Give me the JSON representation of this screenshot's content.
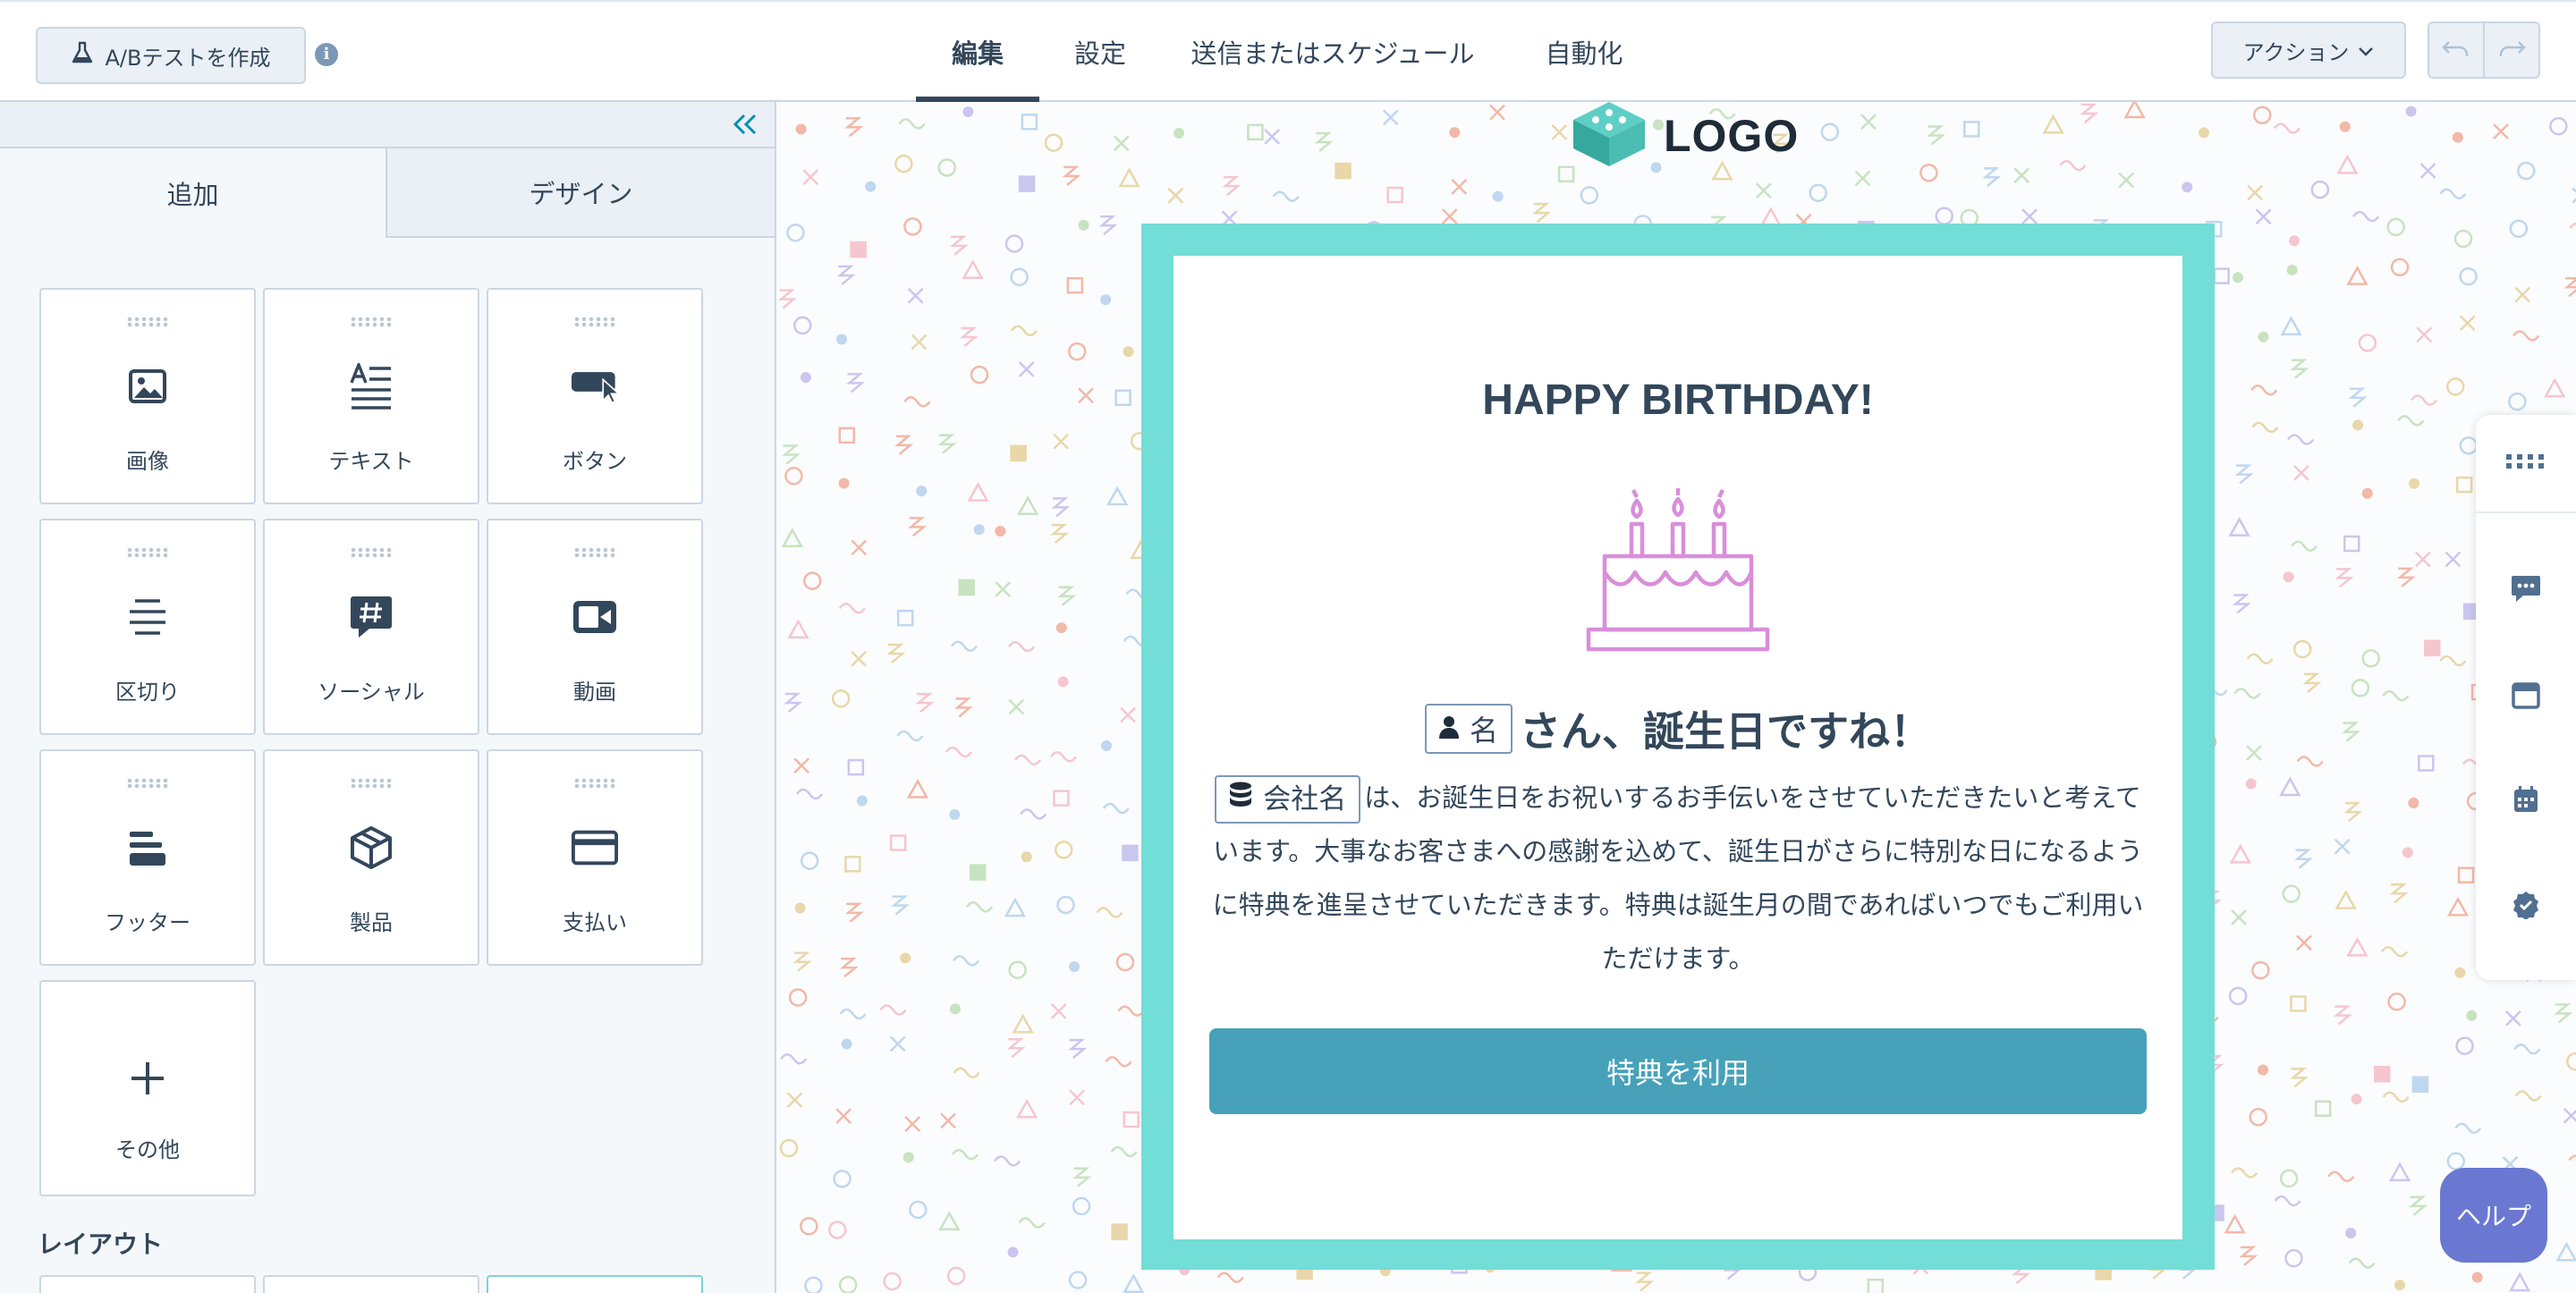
{
  "toolbar": {
    "ab_test_label": "A/Bテストを作成",
    "info_glyph": "i",
    "actions_label": "アクション"
  },
  "tabs": [
    {
      "label": "編集",
      "active": true
    },
    {
      "label": "設定",
      "active": false
    },
    {
      "label": "送信またはスケジュール",
      "active": false
    },
    {
      "label": "自動化",
      "active": false
    }
  ],
  "panel": {
    "tabs": [
      {
        "label": "追加",
        "active": true
      },
      {
        "label": "デザイン",
        "active": false
      }
    ],
    "modules": [
      {
        "label": "画像",
        "icon": "image-icon"
      },
      {
        "label": "テキスト",
        "icon": "text-icon"
      },
      {
        "label": "ボタン",
        "icon": "button-icon"
      },
      {
        "label": "区切り",
        "icon": "divider-icon"
      },
      {
        "label": "ソーシャル",
        "icon": "social-icon"
      },
      {
        "label": "動画",
        "icon": "video-icon"
      },
      {
        "label": "フッター",
        "icon": "footer-icon"
      },
      {
        "label": "製品",
        "icon": "product-icon"
      },
      {
        "label": "支払い",
        "icon": "payment-icon"
      },
      {
        "label": "その他",
        "icon": "plus-icon"
      }
    ],
    "layout_title": "レイアウト"
  },
  "email": {
    "logo_text": "LOGO",
    "title": "HAPPY BIRTHDAY!",
    "first_name_token": "名",
    "greeting_suffix": "さん、誕生日ですね！",
    "company_token": "会社名",
    "body": "は、お誕生日をお祝いするお手伝いをさせていただきたいと考えています。大事なお客さまへの感謝を込めて、誕生日がさらに特別な日になるように特典を進呈させていただきます。特典は誕生月の間であればいつでもご利用いただけます。",
    "cta_label": "特典を利用"
  },
  "help_label": "ヘルプ",
  "colors": {
    "frame": "#73ddd7",
    "cta": "#46a1b9",
    "cake": "#d98ed9",
    "help": "#6a78d1",
    "text": "#33475b"
  }
}
